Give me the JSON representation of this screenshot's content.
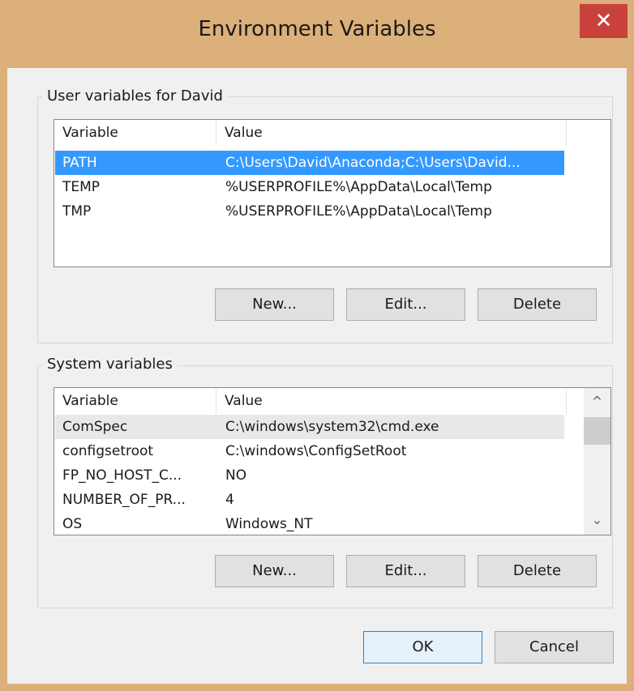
{
  "window": {
    "title": "Environment Variables",
    "close_glyph": "✕"
  },
  "user_group": {
    "label": "User variables for David",
    "columns": [
      "Variable",
      "Value"
    ],
    "rows": [
      {
        "variable": "PATH",
        "value": "C:\\Users\\David\\Anaconda;C:\\Users\\David..."
      },
      {
        "variable": "TEMP",
        "value": "%USERPROFILE%\\AppData\\Local\\Temp"
      },
      {
        "variable": "TMP",
        "value": "%USERPROFILE%\\AppData\\Local\\Temp"
      }
    ],
    "buttons": {
      "new": "New...",
      "edit": "Edit...",
      "delete": "Delete"
    }
  },
  "system_group": {
    "label": "System variables",
    "columns": [
      "Variable",
      "Value"
    ],
    "rows": [
      {
        "variable": "ComSpec",
        "value": "C:\\windows\\system32\\cmd.exe"
      },
      {
        "variable": "configsetroot",
        "value": "C:\\windows\\ConfigSetRoot"
      },
      {
        "variable": "FP_NO_HOST_C...",
        "value": "NO"
      },
      {
        "variable": "NUMBER_OF_PR...",
        "value": "4"
      },
      {
        "variable": "OS",
        "value": "Windows_NT"
      }
    ],
    "buttons": {
      "new": "New...",
      "edit": "Edit...",
      "delete": "Delete"
    }
  },
  "footer": {
    "ok": "OK",
    "cancel": "Cancel"
  }
}
